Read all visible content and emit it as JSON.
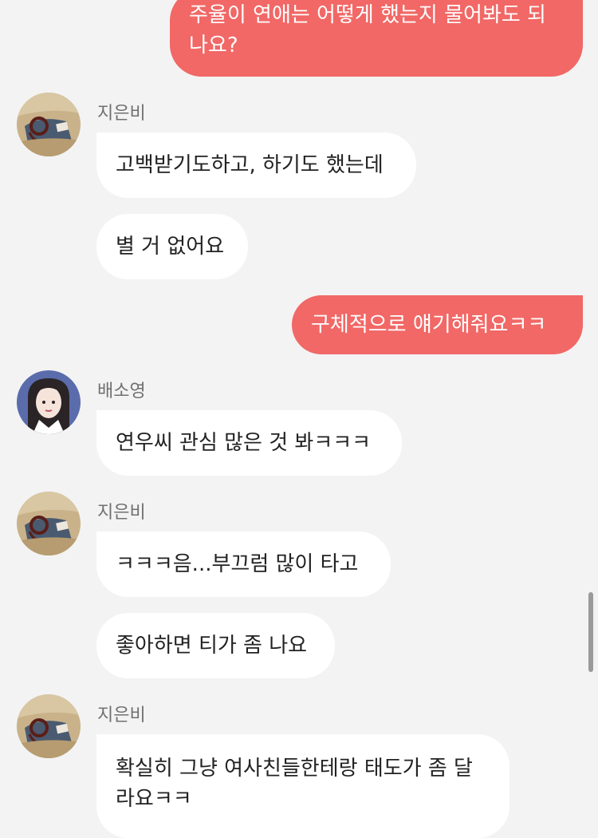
{
  "messages": [
    {
      "direction": "outgoing",
      "lines": [
        "주율이 연애는 어떻게 했는지 물어봐도 되",
        "나요?"
      ]
    },
    {
      "direction": "incoming",
      "sender": "지은비",
      "avatar_icon": "jieunbi-avatar-photo",
      "lines": [
        "고백받기도하고, 하기도 했는데"
      ]
    },
    {
      "direction": "incoming",
      "lines": [
        "별 거 없어요"
      ]
    },
    {
      "direction": "outgoing",
      "lines": [
        "구체적으로 얘기해줘요ㅋㅋ"
      ]
    },
    {
      "direction": "incoming",
      "sender": "배소영",
      "avatar_icon": "baesoyoung-avatar-illustration",
      "lines": [
        "연우씨 관심 많은 것 봐ㅋㅋㅋ"
      ]
    },
    {
      "direction": "incoming",
      "sender": "지은비",
      "avatar_icon": "jieunbi-avatar-photo",
      "lines": [
        "ㅋㅋㅋ음...부끄럼 많이 타고"
      ]
    },
    {
      "direction": "incoming",
      "lines": [
        "좋아하면 티가 좀 나요"
      ]
    },
    {
      "direction": "incoming",
      "sender": "지은비",
      "avatar_icon": "jieunbi-avatar-photo",
      "lines": [
        "확실히 그냥 여사친들한테랑 태도가 좀 달",
        "라요ㅋㅋ"
      ]
    }
  ],
  "colors": {
    "background": "#f3f3f3",
    "outgoing_bubble": "#f16866",
    "incoming_bubble": "#ffffff",
    "sender_name": "#707070"
  }
}
